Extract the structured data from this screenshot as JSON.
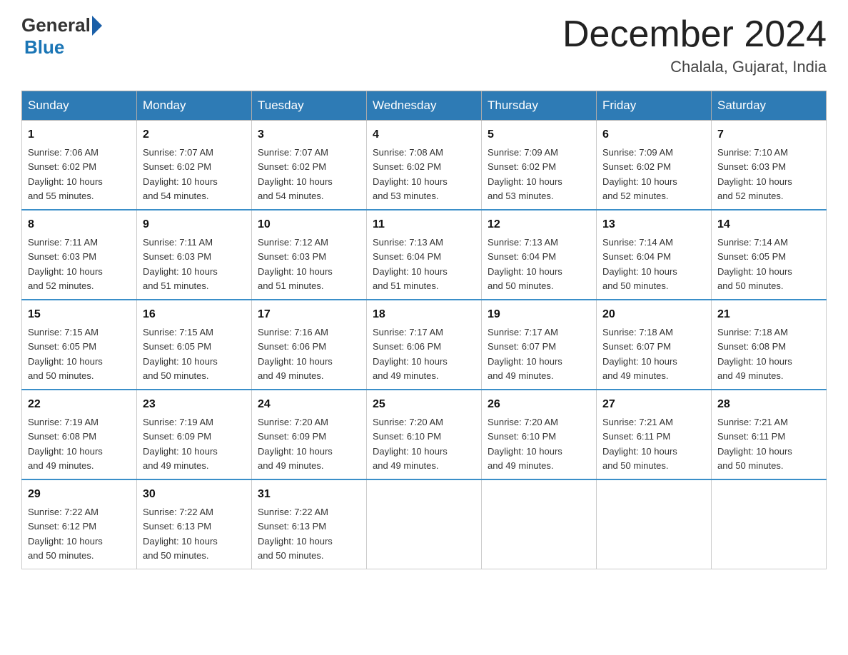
{
  "header": {
    "logo_general": "General",
    "logo_blue": "Blue",
    "month_title": "December 2024",
    "location": "Chalala, Gujarat, India"
  },
  "days_of_week": [
    "Sunday",
    "Monday",
    "Tuesday",
    "Wednesday",
    "Thursday",
    "Friday",
    "Saturday"
  ],
  "weeks": [
    [
      {
        "day": "1",
        "sunrise": "7:06 AM",
        "sunset": "6:02 PM",
        "daylight": "10 hours and 55 minutes."
      },
      {
        "day": "2",
        "sunrise": "7:07 AM",
        "sunset": "6:02 PM",
        "daylight": "10 hours and 54 minutes."
      },
      {
        "day": "3",
        "sunrise": "7:07 AM",
        "sunset": "6:02 PM",
        "daylight": "10 hours and 54 minutes."
      },
      {
        "day": "4",
        "sunrise": "7:08 AM",
        "sunset": "6:02 PM",
        "daylight": "10 hours and 53 minutes."
      },
      {
        "day": "5",
        "sunrise": "7:09 AM",
        "sunset": "6:02 PM",
        "daylight": "10 hours and 53 minutes."
      },
      {
        "day": "6",
        "sunrise": "7:09 AM",
        "sunset": "6:02 PM",
        "daylight": "10 hours and 52 minutes."
      },
      {
        "day": "7",
        "sunrise": "7:10 AM",
        "sunset": "6:03 PM",
        "daylight": "10 hours and 52 minutes."
      }
    ],
    [
      {
        "day": "8",
        "sunrise": "7:11 AM",
        "sunset": "6:03 PM",
        "daylight": "10 hours and 52 minutes."
      },
      {
        "day": "9",
        "sunrise": "7:11 AM",
        "sunset": "6:03 PM",
        "daylight": "10 hours and 51 minutes."
      },
      {
        "day": "10",
        "sunrise": "7:12 AM",
        "sunset": "6:03 PM",
        "daylight": "10 hours and 51 minutes."
      },
      {
        "day": "11",
        "sunrise": "7:13 AM",
        "sunset": "6:04 PM",
        "daylight": "10 hours and 51 minutes."
      },
      {
        "day": "12",
        "sunrise": "7:13 AM",
        "sunset": "6:04 PM",
        "daylight": "10 hours and 50 minutes."
      },
      {
        "day": "13",
        "sunrise": "7:14 AM",
        "sunset": "6:04 PM",
        "daylight": "10 hours and 50 minutes."
      },
      {
        "day": "14",
        "sunrise": "7:14 AM",
        "sunset": "6:05 PM",
        "daylight": "10 hours and 50 minutes."
      }
    ],
    [
      {
        "day": "15",
        "sunrise": "7:15 AM",
        "sunset": "6:05 PM",
        "daylight": "10 hours and 50 minutes."
      },
      {
        "day": "16",
        "sunrise": "7:15 AM",
        "sunset": "6:05 PM",
        "daylight": "10 hours and 50 minutes."
      },
      {
        "day": "17",
        "sunrise": "7:16 AM",
        "sunset": "6:06 PM",
        "daylight": "10 hours and 49 minutes."
      },
      {
        "day": "18",
        "sunrise": "7:17 AM",
        "sunset": "6:06 PM",
        "daylight": "10 hours and 49 minutes."
      },
      {
        "day": "19",
        "sunrise": "7:17 AM",
        "sunset": "6:07 PM",
        "daylight": "10 hours and 49 minutes."
      },
      {
        "day": "20",
        "sunrise": "7:18 AM",
        "sunset": "6:07 PM",
        "daylight": "10 hours and 49 minutes."
      },
      {
        "day": "21",
        "sunrise": "7:18 AM",
        "sunset": "6:08 PM",
        "daylight": "10 hours and 49 minutes."
      }
    ],
    [
      {
        "day": "22",
        "sunrise": "7:19 AM",
        "sunset": "6:08 PM",
        "daylight": "10 hours and 49 minutes."
      },
      {
        "day": "23",
        "sunrise": "7:19 AM",
        "sunset": "6:09 PM",
        "daylight": "10 hours and 49 minutes."
      },
      {
        "day": "24",
        "sunrise": "7:20 AM",
        "sunset": "6:09 PM",
        "daylight": "10 hours and 49 minutes."
      },
      {
        "day": "25",
        "sunrise": "7:20 AM",
        "sunset": "6:10 PM",
        "daylight": "10 hours and 49 minutes."
      },
      {
        "day": "26",
        "sunrise": "7:20 AM",
        "sunset": "6:10 PM",
        "daylight": "10 hours and 49 minutes."
      },
      {
        "day": "27",
        "sunrise": "7:21 AM",
        "sunset": "6:11 PM",
        "daylight": "10 hours and 50 minutes."
      },
      {
        "day": "28",
        "sunrise": "7:21 AM",
        "sunset": "6:11 PM",
        "daylight": "10 hours and 50 minutes."
      }
    ],
    [
      {
        "day": "29",
        "sunrise": "7:22 AM",
        "sunset": "6:12 PM",
        "daylight": "10 hours and 50 minutes."
      },
      {
        "day": "30",
        "sunrise": "7:22 AM",
        "sunset": "6:13 PM",
        "daylight": "10 hours and 50 minutes."
      },
      {
        "day": "31",
        "sunrise": "7:22 AM",
        "sunset": "6:13 PM",
        "daylight": "10 hours and 50 minutes."
      },
      null,
      null,
      null,
      null
    ]
  ],
  "labels": {
    "sunrise": "Sunrise:",
    "sunset": "Sunset:",
    "daylight": "Daylight:"
  }
}
